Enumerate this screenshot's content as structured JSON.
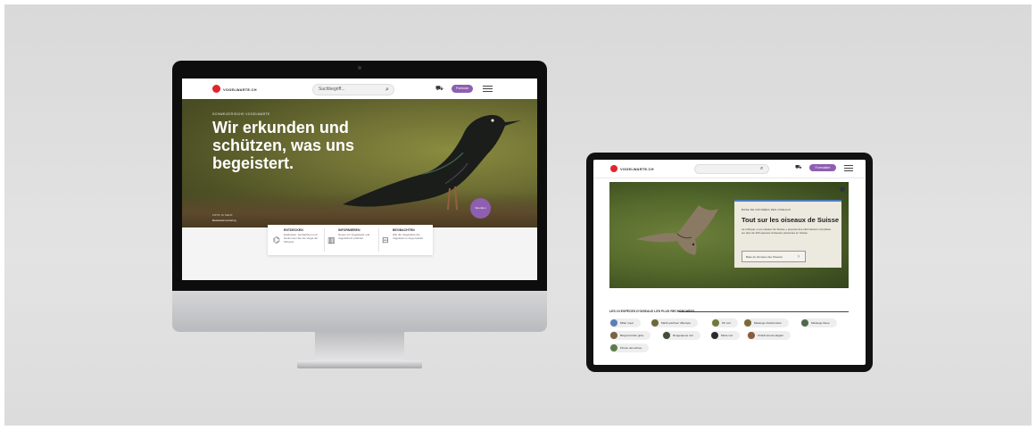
{
  "desktop": {
    "brand": "VOGELWARTE.CH",
    "search_placeholder": "Suchbegriff...",
    "menu_pill": "Formular",
    "hero": {
      "eyebrow": "SCHWEIZERISCHE VOGELWARTE",
      "title": "Wir erkunden und schützen, was uns begeistert.",
      "caption": "FOTO: M. FELIX",
      "link": "Bestandsmonitoring"
    },
    "fab": "Spenden",
    "features": [
      {
        "icon": "binoculars-icon",
        "title": "ENTDECKEN",
        "text": "Entdecken, beobachten und bestimmen Sie die Vögel der Schweiz."
      },
      {
        "icon": "map-icon",
        "title": "INFORMIEREN",
        "text": "Neues zur Vogelwarte und Vogelschutz erfahren."
      },
      {
        "icon": "device-icon",
        "title": "BEOBACHTEN",
        "text": "Wie die Vogelwarte die Vogelwelt im Auge behält."
      }
    ]
  },
  "tablet": {
    "brand": "VOGELWARTE.CH",
    "menu_pill": "Formulaire",
    "card": {
      "eyebrow": "BASE DE DONNÉES DES OISEAUX",
      "title": "Tout sur les oiseaux de Suisse",
      "body": "La rubrique « Les oiseaux de Suisse » propose des informations complètes sur plus de 400 espèces d'oiseaux présentes en Suisse.",
      "button": "Base de données des Oiseaux"
    },
    "list_title": "LES 10 ESPÈCES D'OISEAUX LES PLUS RECHERCHÉES",
    "chips": [
      "Milan royal",
      "Martin-pêcheur d'Europe",
      "Pic vert",
      "Mésange charbonnière",
      "Mésange bleue",
      "Bergeronnette grise",
      "Rougequeue noir",
      "Merle noir",
      "Chardonneret élégant",
      "Pinson des arbres"
    ]
  },
  "colors": {
    "accent": "#8e5fb0",
    "brand_red": "#e2252b",
    "card_border": "#4e7cc2"
  }
}
